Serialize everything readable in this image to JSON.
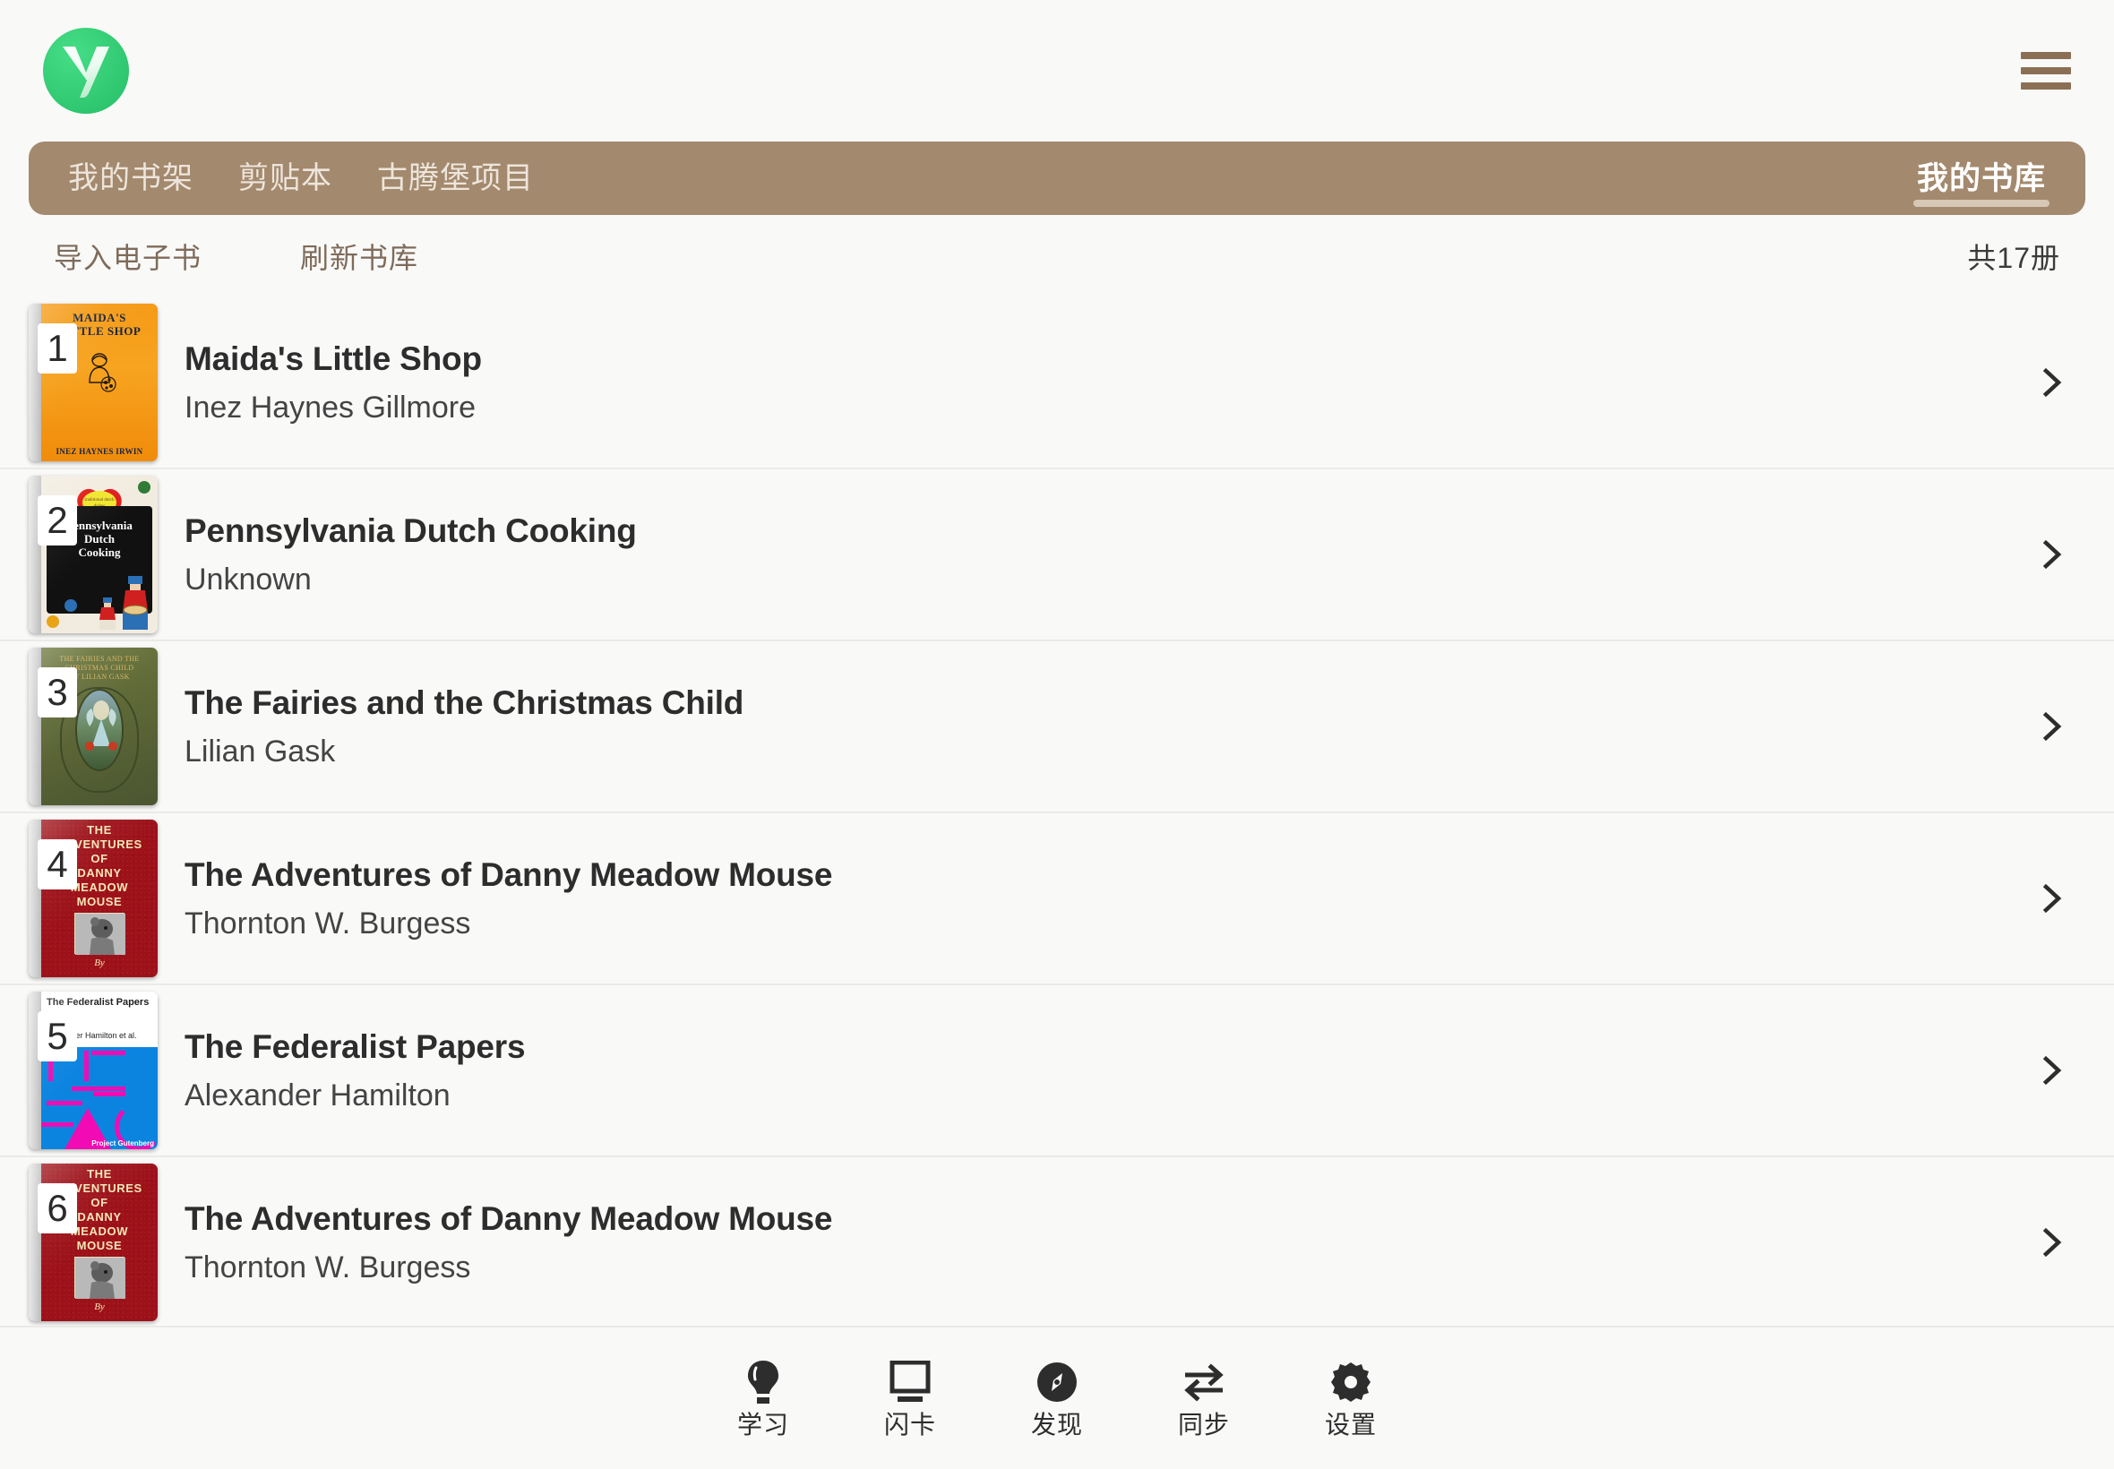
{
  "app": {
    "logo_letter": "y",
    "logo_color": "#2fc76f",
    "menu_icon": "hamburger-icon"
  },
  "tabbar": {
    "accent_color": "#a3896d",
    "tabs": [
      {
        "label": "我的书架",
        "active": false
      },
      {
        "label": "剪贴本",
        "active": false
      },
      {
        "label": "古腾堡项目",
        "active": false
      }
    ],
    "right_tab": {
      "label": "我的书库",
      "active": true
    }
  },
  "actions": {
    "import_label": "导入电子书",
    "refresh_label": "刷新书库",
    "count_label": "共17册"
  },
  "books": [
    {
      "index": "1",
      "title": "Maida's Little Shop",
      "author": "Inez Haynes Gillmore",
      "cover": "maida",
      "cover_title": "MAIDA'S<br>LITTLE SHOP",
      "cover_author": "INEZ HAYNES IRWIN"
    },
    {
      "index": "2",
      "title": "Pennsylvania Dutch Cooking",
      "author": "Unknown",
      "cover": "dutch",
      "cover_title": "Pennsylvania<br>Dutch<br>Cooking",
      "cover_author": "traditional dutch dishes"
    },
    {
      "index": "3",
      "title": "The Fairies and the Christmas Child",
      "author": "Lilian Gask",
      "cover": "fairies",
      "cover_title": "THE FAIRIES AND THE<br>CHRISTMAS CHILD",
      "cover_author": "BY LILIAN GASK"
    },
    {
      "index": "4",
      "title": "The Adventures of Danny Meadow Mouse",
      "author": "Thornton W. Burgess",
      "cover": "danny",
      "cover_title": "THE<br>ADVENTURES<br>OF<br>DANNY<br>MEADOW<br>MOUSE",
      "cover_author": "By"
    },
    {
      "index": "5",
      "title": "The Federalist Papers",
      "author": "Alexander Hamilton",
      "cover": "federalist",
      "cover_title": "The Federalist Papers",
      "cover_author": "Alexander Hamilton et al.",
      "cover_footer": "Project Gutenberg"
    },
    {
      "index": "6",
      "title": "The Adventures of Danny Meadow Mouse",
      "author": "Thornton W. Burgess",
      "cover": "danny",
      "cover_title": "THE<br>ADVENTURES<br>OF<br>DANNY<br>MEADOW<br>MOUSE",
      "cover_author": "By"
    }
  ],
  "bottomnav": [
    {
      "label": "学习",
      "icon": "lightbulb-icon"
    },
    {
      "label": "闪卡",
      "icon": "flashcard-screen-icon"
    },
    {
      "label": "发现",
      "icon": "compass-icon"
    },
    {
      "label": "同步",
      "icon": "sync-arrows-icon"
    },
    {
      "label": "设置",
      "icon": "gear-icon"
    }
  ]
}
